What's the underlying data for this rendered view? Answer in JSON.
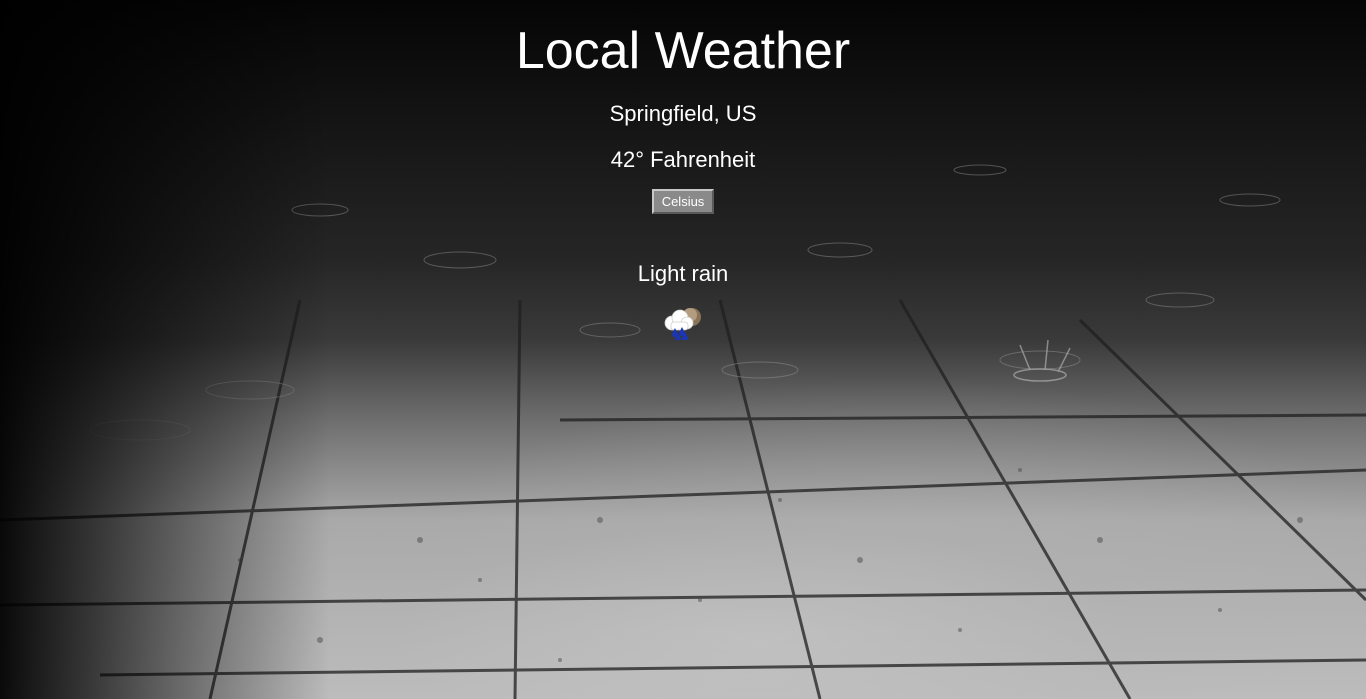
{
  "app": {
    "title": "Local Weather"
  },
  "weather": {
    "location": "Springfield, US",
    "temperature": "42° Fahrenheit",
    "unit_toggle_label": "Celsius",
    "condition": "Light rain",
    "icon": "light-rain-icon"
  },
  "colors": {
    "text": "#ffffff",
    "button_bg": "#8a8a8a"
  }
}
